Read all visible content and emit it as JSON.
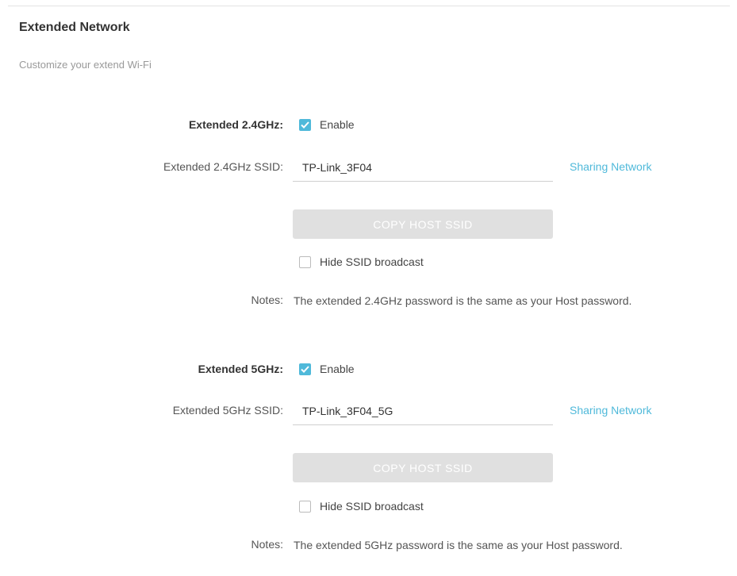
{
  "section": {
    "title": "Extended Network",
    "subtitle": "Customize your extend Wi-Fi"
  },
  "band_24": {
    "label": "Extended 2.4GHz:",
    "enable_label": "Enable",
    "enable_checked": true,
    "ssid_label": "Extended 2.4GHz SSID:",
    "ssid_value": "TP-Link_3F04",
    "sharing_link": "Sharing Network",
    "copy_button": "COPY HOST SSID",
    "hide_ssid_label": "Hide SSID broadcast",
    "hide_ssid_checked": false,
    "notes_label": "Notes:",
    "notes_text": "The extended 2.4GHz password is the same as your Host password."
  },
  "band_5": {
    "label": "Extended 5GHz:",
    "enable_label": "Enable",
    "enable_checked": true,
    "ssid_label": "Extended 5GHz SSID:",
    "ssid_value": "TP-Link_3F04_5G",
    "sharing_link": "Sharing Network",
    "copy_button": "COPY HOST SSID",
    "hide_ssid_label": "Hide SSID broadcast",
    "hide_ssid_checked": false,
    "notes_label": "Notes:",
    "notes_text": "The extended 5GHz password is the same as your Host password."
  },
  "colors": {
    "accent": "#4fb9da",
    "button_disabled": "#e0e0e0"
  },
  "icons": {
    "checkbox_checked": "checkmark-icon"
  }
}
